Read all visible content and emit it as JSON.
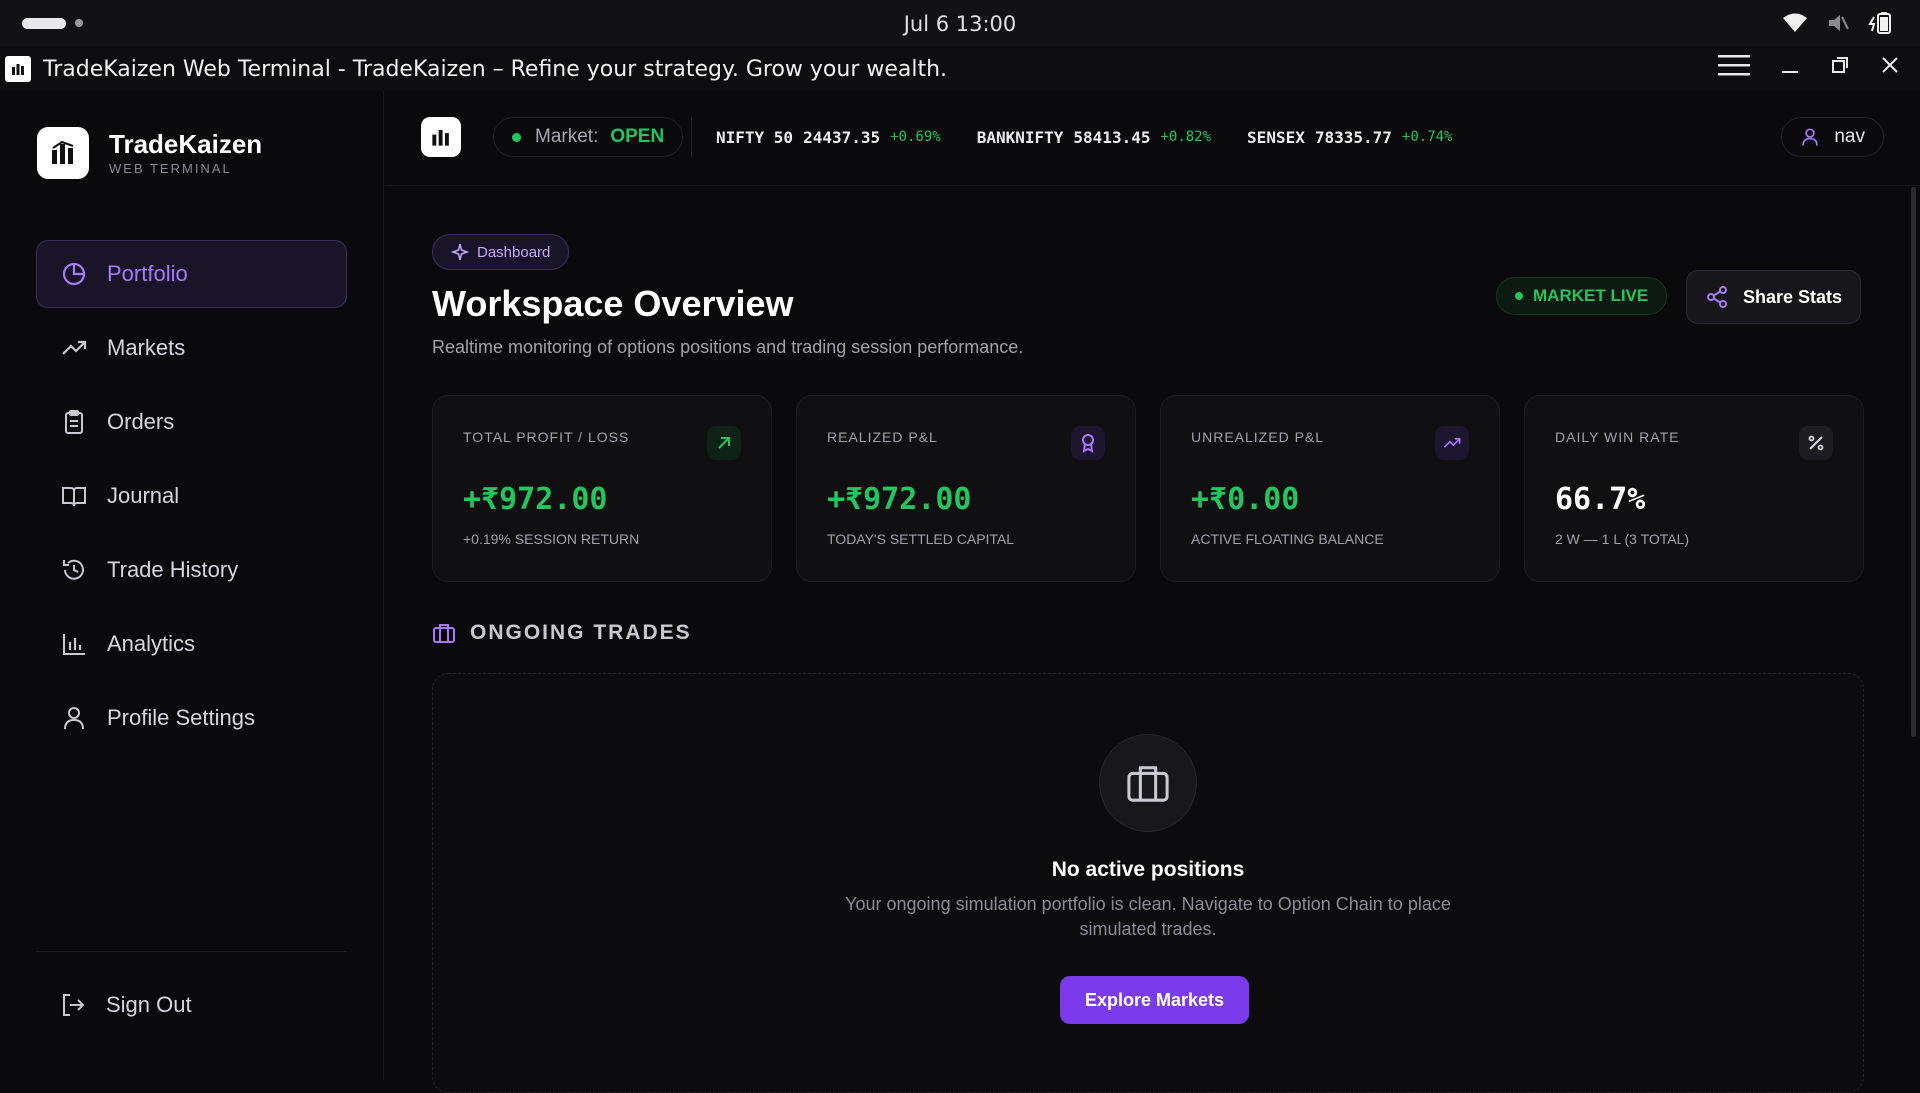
{
  "system": {
    "clock": "Jul 6  13:00"
  },
  "window": {
    "title": "TradeKaizen Web Terminal - TradeKaizen – Refine your strategy. Grow your wealth."
  },
  "brand": {
    "name": "TradeKaizen",
    "sub": "WEB TERMINAL"
  },
  "nav": [
    {
      "label": "Portfolio",
      "icon": "pie-chart-icon",
      "active": true
    },
    {
      "label": "Markets",
      "icon": "trending-up-icon"
    },
    {
      "label": "Orders",
      "icon": "clipboard-icon"
    },
    {
      "label": "Journal",
      "icon": "book-icon"
    },
    {
      "label": "Trade History",
      "icon": "history-icon"
    },
    {
      "label": "Analytics",
      "icon": "bar-chart-icon"
    },
    {
      "label": "Profile Settings",
      "icon": "user-icon"
    }
  ],
  "signout": "Sign Out",
  "market": {
    "label": "Market:",
    "status": "OPEN"
  },
  "ticker": [
    {
      "name": "NIFTY 50",
      "value": "24437.35",
      "change": "+0.69%"
    },
    {
      "name": "BANKNIFTY",
      "value": "58413.45",
      "change": "+0.82%"
    },
    {
      "name": "SENSEX",
      "value": "78335.77",
      "change": "+0.74%"
    }
  ],
  "user": {
    "name": "nav"
  },
  "page": {
    "crumb": "Dashboard",
    "title": "Workspace Overview",
    "lede": "Realtime monitoring of options positions and trading session performance.",
    "live": "MARKET LIVE",
    "share": "Share Stats"
  },
  "cards": [
    {
      "label": "TOTAL PROFIT / LOSS",
      "value": "+₹972.00",
      "foot": "+0.19% SESSION RETURN",
      "color": "#22c55e",
      "icon": "arrow-up-right-icon"
    },
    {
      "label": "REALIZED P&L",
      "value": "+₹972.00",
      "foot": "TODAY'S SETTLED CAPITAL",
      "color": "#22c55e",
      "icon": "award-icon"
    },
    {
      "label": "UNREALIZED P&L",
      "value": "+₹0.00",
      "foot": "ACTIVE FLOATING BALANCE",
      "color": "#22c55e",
      "icon": "trending-up-icon"
    },
    {
      "label": "DAILY WIN RATE",
      "value": "66.7%",
      "foot": "2 W — 1 L (3 TOTAL)",
      "color": "#ffffff",
      "icon": "percent-icon"
    }
  ],
  "ongoing": {
    "heading": "ONGOING TRADES",
    "empty_title": "No active positions",
    "empty_desc": "Your ongoing simulation portfolio is clean. Navigate to Option Chain to place simulated trades.",
    "button": "Explore Markets"
  }
}
